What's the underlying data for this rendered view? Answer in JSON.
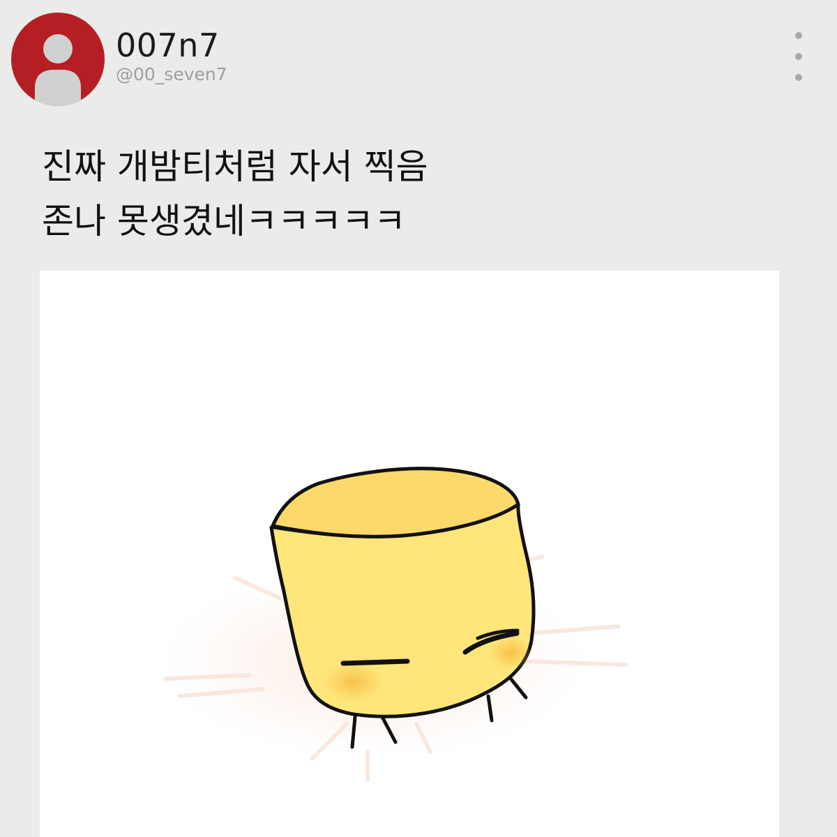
{
  "post": {
    "author": {
      "display_name": "007n7",
      "handle": "@00_seven7",
      "avatar_color": "#b51f24"
    },
    "menu_icon": "more-vertical-icon",
    "text_lines": [
      "진짜 개밤티처럼 자서 찍음",
      "존나 못생겼네ㅋㅋㅋㅋㅋ"
    ],
    "image": {
      "subject": "yellow-cube-character-drawing",
      "colors": {
        "body": "#ffe57a",
        "top": "#fcd96a",
        "blush": "#f7c24a",
        "outline": "#111111"
      }
    }
  }
}
